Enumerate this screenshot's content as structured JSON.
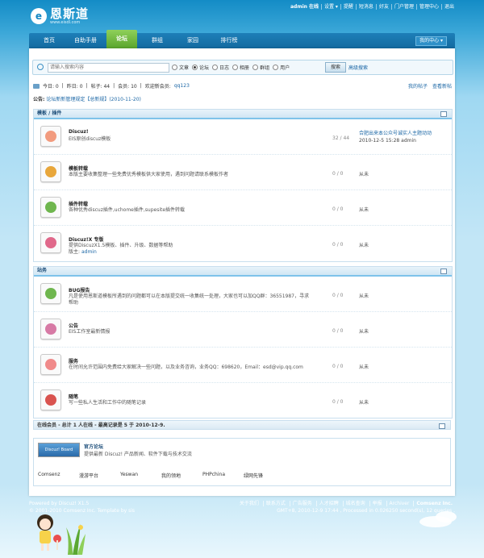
{
  "site": {
    "logo_letter": "e",
    "title": "恩斯道",
    "url": "www.eisdl.com"
  },
  "topbar": [
    "admin 在线",
    "设置 ▾",
    "提醒",
    "短消息",
    "好友",
    "门户管理",
    "管理中心",
    "退出"
  ],
  "nav": {
    "items": [
      "首页",
      "自助手册",
      "论坛",
      "群组",
      "家园",
      "排行榜"
    ],
    "active_index": 2,
    "my_center": "我的中心 ▾"
  },
  "search": {
    "placeholder": "请输入搜索内容",
    "options": [
      "文章",
      "论坛",
      "日志",
      "相册",
      "群组",
      "用户"
    ],
    "selected": "论坛",
    "button": "搜索",
    "advanced": "高级搜索"
  },
  "stats": {
    "today": "今日: 0",
    "yesterday": "昨日: 0",
    "posts": "帖子: 44",
    "members": "会员: 10",
    "welcome": "欢迎新会员:",
    "newest": "qq123",
    "my_posts": "我的帖子",
    "new_posts": "查看新帖"
  },
  "notice": {
    "label": "公告:",
    "text": "论坛新新管理规定【总新规】(2010-11-20)"
  },
  "groups": [
    {
      "title": "模板 / 插件",
      "forums": [
        {
          "name": "Discuz!",
          "desc": "EIS原创discuz模板",
          "count": "32 / 44",
          "last_title": "合肥出来本公众号诚实人主题动动",
          "last_meta": "2010-12-5 15:28 admin",
          "color": "#f29b7e"
        },
        {
          "name": "模板转载",
          "desc": "本版主要收集整理一些免费优秀模板供大家使用，遇到问题请联系模板作者",
          "count": "0 / 0",
          "last_title": "从未",
          "last_meta": "",
          "color": "#e8a63a"
        },
        {
          "name": "插件转载",
          "desc": "各种优秀discuz插件,uchome插件,supesite插件转载",
          "count": "0 / 0",
          "last_title": "从未",
          "last_meta": "",
          "color": "#6fb64e"
        },
        {
          "name": "Discuz!X 专版",
          "desc": "提供DiscuzX1.5模板、插件、升级、数据等帮助",
          "moderator_label": "版主:",
          "moderator": "admin",
          "count": "0 / 0",
          "last_title": "从未",
          "last_meta": "",
          "color": "#e0688a"
        }
      ]
    },
    {
      "title": "站务",
      "forums": [
        {
          "name": "BUG报告",
          "desc": "凡是使用恩斯道模板所遇到的问题都可以在本版提交统一收集统一处理，大家也可以加QQ群：36551987，寻求帮助",
          "count": "0 / 0",
          "last_title": "从未",
          "last_meta": "",
          "color": "#6fb64e"
        },
        {
          "name": "公告",
          "desc": "EIS工作室最新情报",
          "count": "0 / 0",
          "last_title": "从未",
          "last_meta": "",
          "color": "#d77aa5"
        },
        {
          "name": "服务",
          "desc": "在时间允许范围内免费给大家解决一些问题，以及业务咨询，业务QQ：698620，Email：esd@vip.qq.com",
          "count": "0 / 0",
          "last_title": "从未",
          "last_meta": "",
          "color": "#f08a8a"
        },
        {
          "name": "随笔",
          "desc": "写一些私人生活和工作中的随笔记录",
          "count": "0 / 0",
          "last_title": "从未",
          "last_meta": "",
          "color": "#d9534f"
        }
      ]
    }
  ],
  "online": "在线会员 - 总计 1 人在线 - 最高记录是 5 于 2010-12-9.",
  "links": {
    "logo_text": "Discuz! Board",
    "name": "官方论坛",
    "desc": "提供最新 Discuz! 产品新闻、软件下载与技术交流",
    "row": [
      "Comsenz",
      "漫游平台",
      "Yeswan",
      "我的领地",
      "PHPchina",
      "绿网先锋"
    ]
  },
  "footer": {
    "powered": "Powered by Discuz! X1.5",
    "copy": "© 2001-2010 Comsenz Inc. Template by sis",
    "links": [
      "关于我们",
      "联系方式",
      "广告服务",
      "人才招聘",
      "城名查询",
      "举报",
      "Archiver",
      "Comsenz Inc."
    ],
    "gmt": "GMT+8, 2010-12-9 17:44 , Processed in 0.026250 second(s), 12 queries ."
  }
}
